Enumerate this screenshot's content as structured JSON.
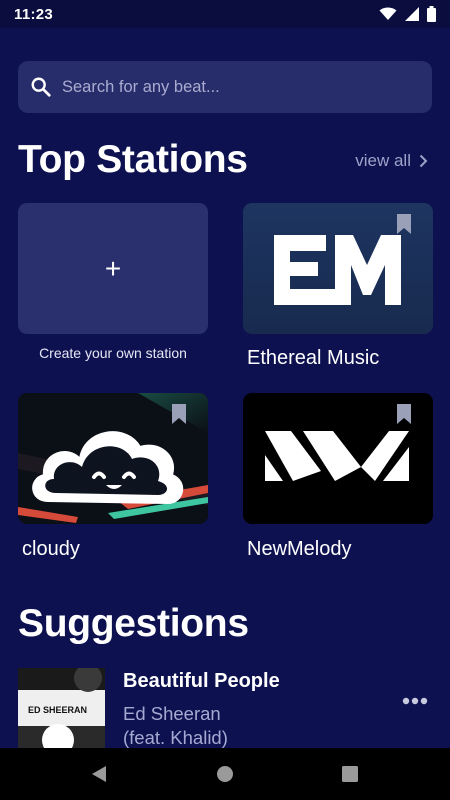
{
  "status_bar": {
    "time": "11:23",
    "icons": [
      "wifi-icon",
      "signal-icon",
      "battery-icon"
    ]
  },
  "search": {
    "placeholder": "Search for any beat...",
    "value": ""
  },
  "top_stations": {
    "title": "Top Stations",
    "view_all_label": "view all",
    "create_label": "Create your own station",
    "stations": [
      {
        "name": "Ethereal Music",
        "logo_text": "EM",
        "bookmarked": true
      },
      {
        "name": "cloudy",
        "bookmarked": true
      },
      {
        "name": "NewMelody",
        "bookmarked": true
      }
    ]
  },
  "suggestions": {
    "title": "Suggestions",
    "items": [
      {
        "title": "Beautiful People",
        "artist_line1": "Ed Sheeran",
        "artist_line2": "(feat. Khalid)",
        "album_text": "ED SHEERAN"
      }
    ]
  },
  "nav": {
    "buttons": [
      "back-icon",
      "home-icon",
      "recents-icon"
    ]
  },
  "colors": {
    "background": "#0d1150",
    "card": "#2a2f6e",
    "muted_text": "#a6aad2"
  }
}
